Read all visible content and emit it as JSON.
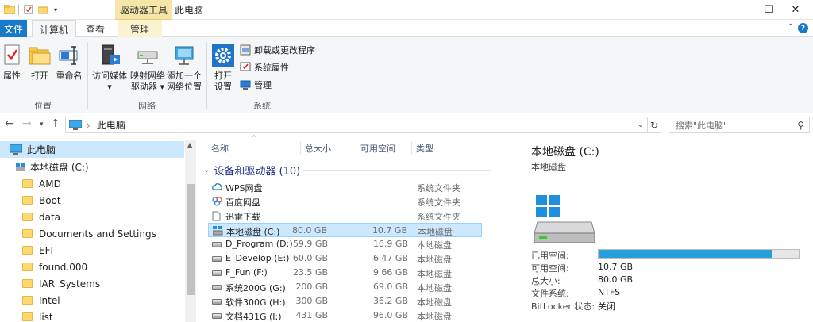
{
  "titlebar": {
    "context_tool": "驱动器工具",
    "title": "此电脑",
    "minimize": "—",
    "maximize": "☐",
    "close": "✕"
  },
  "tabs": {
    "file": "文件",
    "computer": "计算机",
    "view": "查看",
    "manage": "管理"
  },
  "ribbon": {
    "location": {
      "label": "位置",
      "properties": "属性",
      "open": "打开",
      "rename": "重命名"
    },
    "network": {
      "label": "网络",
      "access_media_1": "访问媒体",
      "access_media_2": "▾",
      "map_drive_1": "映射网络",
      "map_drive_2": "驱动器 ▾",
      "add_location_1": "添加一个",
      "add_location_2": "网络位置"
    },
    "system": {
      "label": "系统",
      "open_settings_1": "打开",
      "open_settings_2": "设置",
      "uninstall": "卸载或更改程序",
      "system_properties": "系统属性",
      "manage": "管理"
    }
  },
  "address": {
    "path": "此电脑",
    "search_placeholder": "搜索\"此电脑\""
  },
  "navpane": {
    "items": [
      {
        "label": "此电脑",
        "type": "pc"
      },
      {
        "label": "本地磁盘 (C:)",
        "type": "drive"
      },
      {
        "label": "AMD",
        "type": "folder"
      },
      {
        "label": "Boot",
        "type": "folder"
      },
      {
        "label": "data",
        "type": "folder"
      },
      {
        "label": "Documents and Settings",
        "type": "folder"
      },
      {
        "label": "EFI",
        "type": "folder"
      },
      {
        "label": "found.000",
        "type": "folder"
      },
      {
        "label": "IAR_Systems",
        "type": "folder"
      },
      {
        "label": "Intel",
        "type": "folder"
      },
      {
        "label": "list",
        "type": "folder"
      }
    ]
  },
  "filelist": {
    "columns": {
      "name": "名称",
      "total": "总大小",
      "free": "可用空间",
      "type": "类型"
    },
    "group": "设备和驱动器 (10)",
    "rows": [
      {
        "name": "WPS网盘",
        "total": "",
        "free": "",
        "type": "系统文件夹",
        "icon": "cloud"
      },
      {
        "name": "百度网盘",
        "total": "",
        "free": "",
        "type": "系统文件夹",
        "icon": "baidu"
      },
      {
        "name": "迅雷下载",
        "total": "",
        "free": "",
        "type": "系统文件夹",
        "icon": "doc"
      },
      {
        "name": "本地磁盘 (C:)",
        "total": "80.0 GB",
        "free": "10.7 GB",
        "type": "本地磁盘",
        "icon": "os-drive"
      },
      {
        "name": "D_Program (D:)",
        "total": "59.9 GB",
        "free": "16.9 GB",
        "type": "本地磁盘",
        "icon": "drive"
      },
      {
        "name": "E_Develop (E:)",
        "total": "60.0 GB",
        "free": "6.47 GB",
        "type": "本地磁盘",
        "icon": "drive"
      },
      {
        "name": "F_Fun (F:)",
        "total": "23.5 GB",
        "free": "9.66 GB",
        "type": "本地磁盘",
        "icon": "drive"
      },
      {
        "name": "系统200G (G:)",
        "total": "200 GB",
        "free": "69.0 GB",
        "type": "本地磁盘",
        "icon": "drive"
      },
      {
        "name": "软件300G (H:)",
        "total": "300 GB",
        "free": "36.2 GB",
        "type": "本地磁盘",
        "icon": "drive"
      },
      {
        "name": "文档431G (I:)",
        "total": "431 GB",
        "free": "96.0 GB",
        "type": "本地磁盘",
        "icon": "drive"
      }
    ]
  },
  "details": {
    "title": "本地磁盘 (C:)",
    "subtitle": "本地磁盘",
    "used_label": "已用空间:",
    "used_fraction": 0.866,
    "free_label": "可用空间:",
    "free_value": "10.7 GB",
    "total_label": "总大小:",
    "total_value": "80.0 GB",
    "fs_label": "文件系统:",
    "fs_value": "NTFS",
    "bitlocker_label": "BitLocker 状态:",
    "bitlocker_value": "关闭"
  },
  "colors": {
    "accent": "#1979ca",
    "selection": "#cce8ff",
    "usage_bar": "#26a0da"
  }
}
